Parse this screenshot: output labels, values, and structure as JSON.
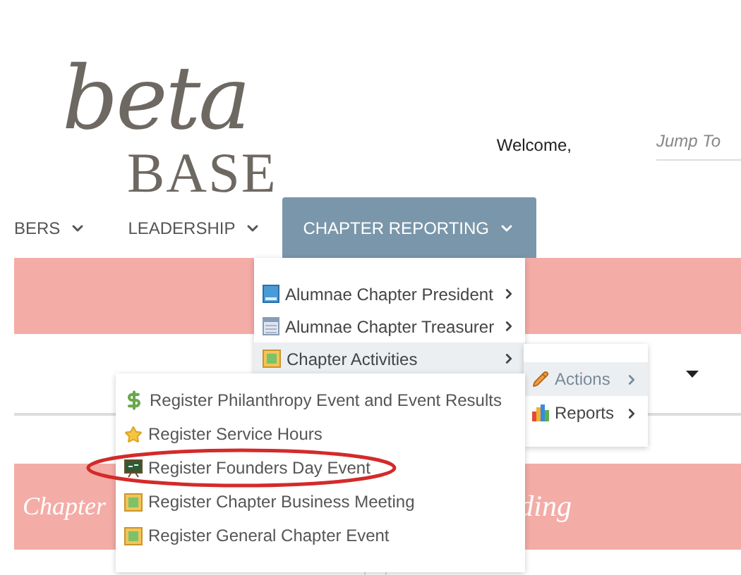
{
  "logo": {
    "script": "beta",
    "word": "BASE"
  },
  "header": {
    "welcome": "Welcome,",
    "jump": {
      "placeholder": "Jump To"
    }
  },
  "nav": [
    {
      "label": "BERS",
      "selected": false
    },
    {
      "label": "LEADERSHIP",
      "selected": false
    },
    {
      "label": "CHAPTER REPORTING",
      "selected": true
    }
  ],
  "menu": [
    {
      "label": "Alumnae Chapter President",
      "kind": "book",
      "selected": false
    },
    {
      "label": "Alumnae Chapter Treasurer",
      "kind": "calendar",
      "selected": false
    },
    {
      "label": "Chapter Activities",
      "kind": "board",
      "selected": true
    }
  ],
  "submenu": [
    {
      "label": "Actions",
      "kind": "pencil",
      "selected": true
    },
    {
      "label": "Reports",
      "kind": "chart",
      "selected": false
    }
  ],
  "actions": [
    {
      "label": "Register Philanthropy Event and Event Results",
      "kind": "dollar",
      "circled": false
    },
    {
      "label": "Register Service Hours",
      "kind": "star",
      "circled": false
    },
    {
      "label": "Register Founders Day Event",
      "kind": "chalkboard",
      "circled": true
    },
    {
      "label": "Register Chapter Business Meeting",
      "kind": "board",
      "circled": false
    },
    {
      "label": "Register General Chapter Event",
      "kind": "board",
      "circled": false
    }
  ],
  "banner": {
    "left": "Chapter",
    "right": "ding"
  }
}
